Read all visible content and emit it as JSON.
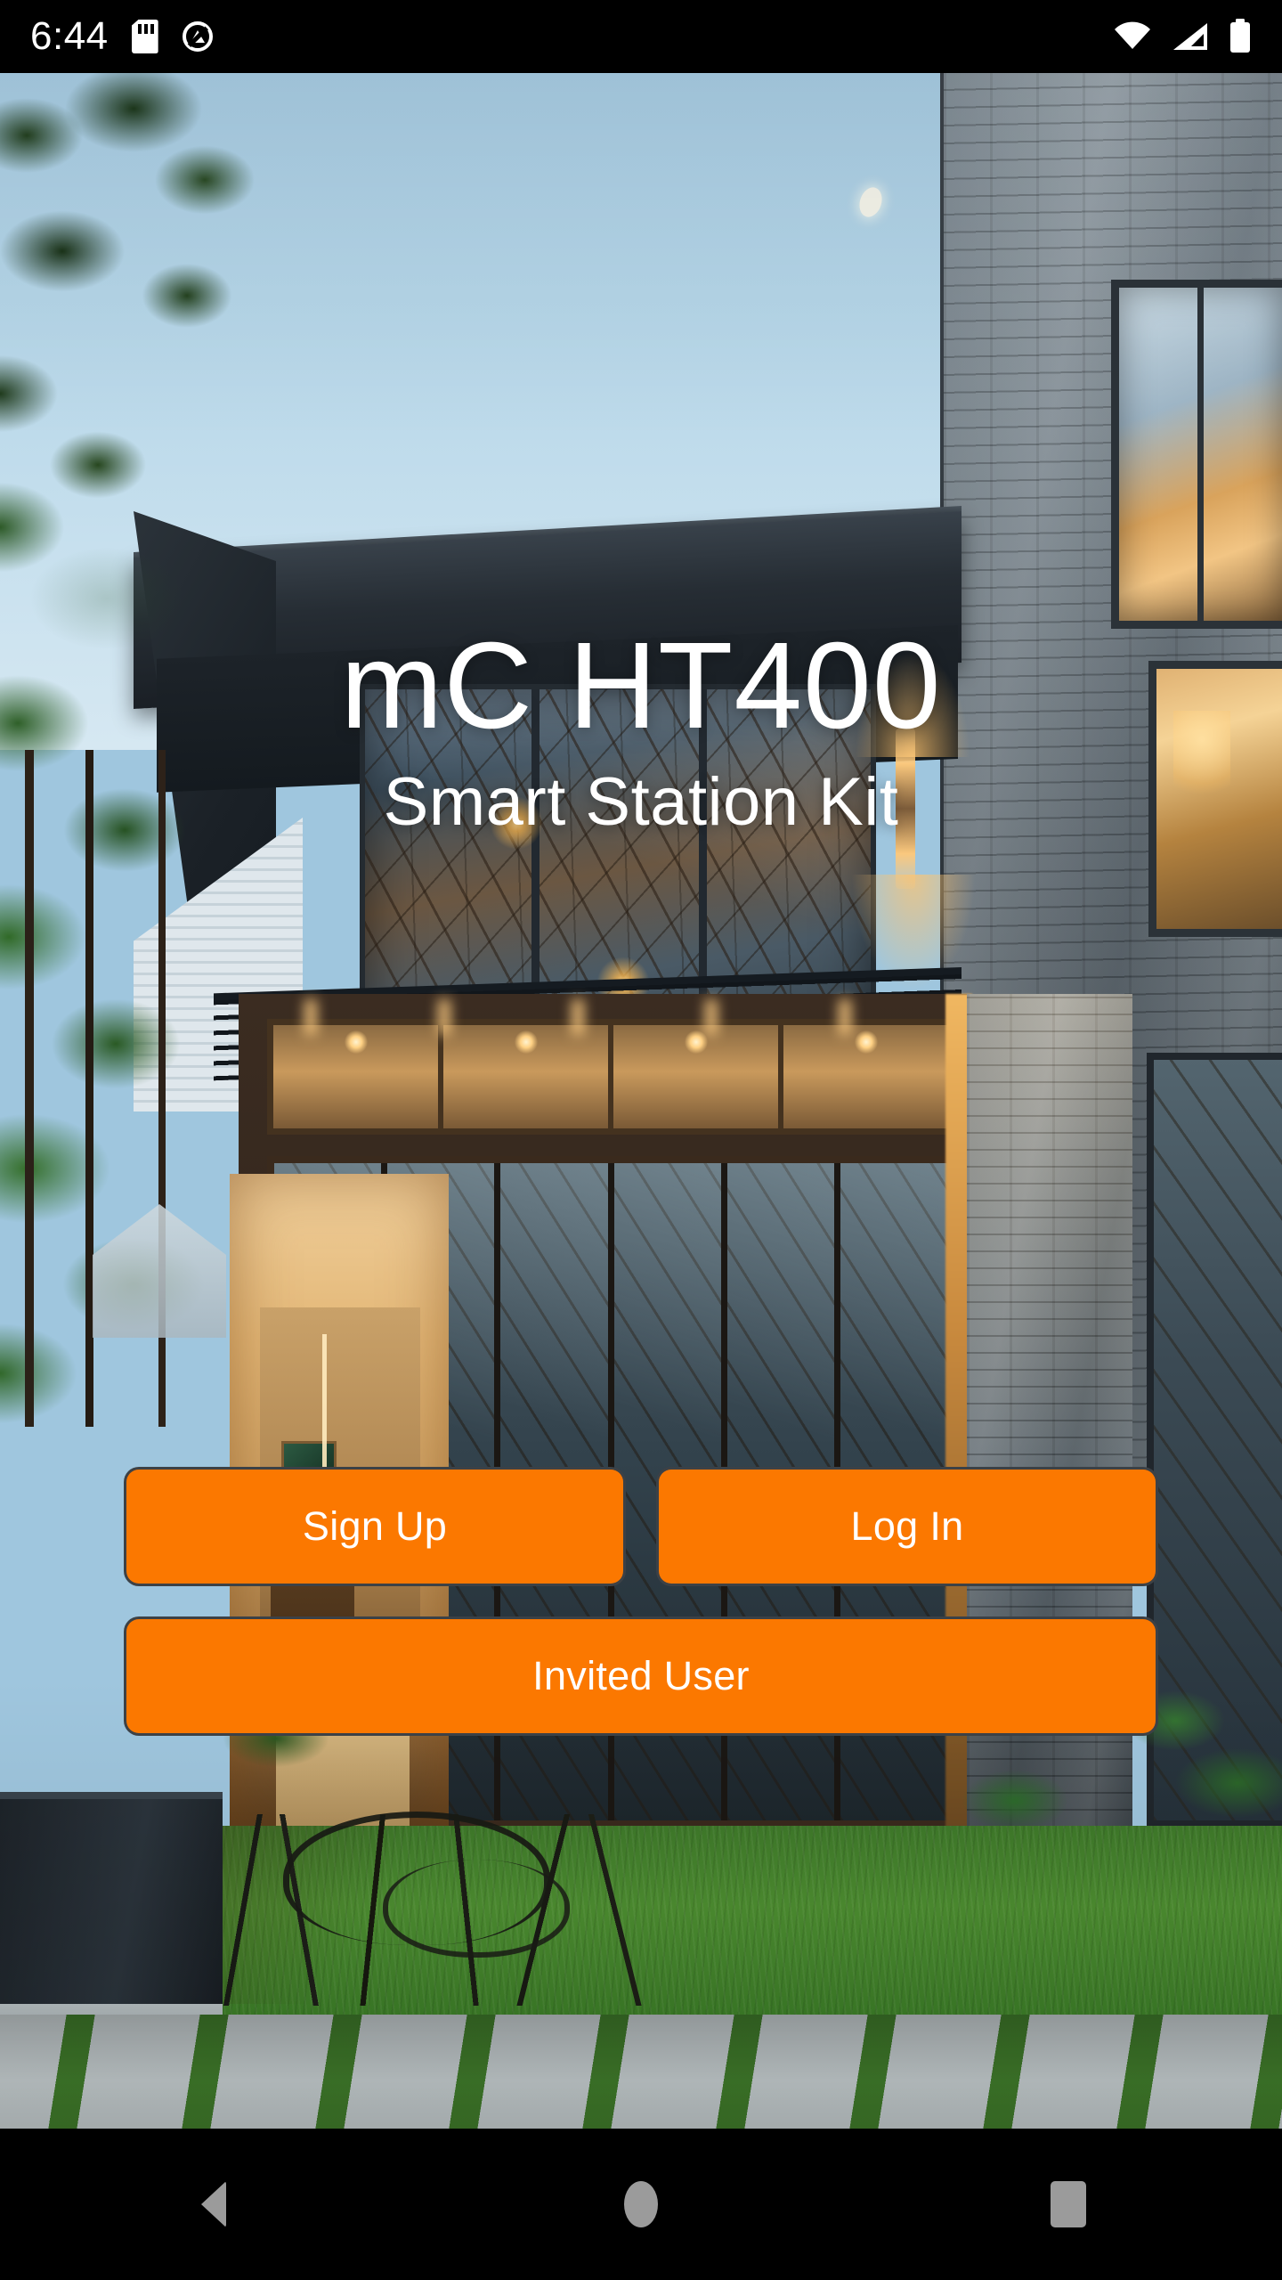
{
  "status_bar": {
    "time": "6:44",
    "icons_left": [
      "sd-card-icon",
      "do-not-disturb-icon"
    ],
    "icons_right": [
      "wifi-icon",
      "cellular-signal-icon",
      "battery-icon"
    ]
  },
  "hero": {
    "title": "mC HT400",
    "subtitle": "Smart Station Kit",
    "background_description": "modern two-story house at dusk with lit interior, stone facade and lawn walkway"
  },
  "actions": {
    "sign_up_label": "Sign Up",
    "log_in_label": "Log In",
    "invited_user_label": "Invited User",
    "accent_color": "#fb7800",
    "button_border_color": "#3c4146",
    "button_text_color": "#ffffff"
  },
  "navigation_bar": {
    "back_label": "Back",
    "home_label": "Home",
    "recents_label": "Recents",
    "icon_color": "#9b9b9b"
  }
}
